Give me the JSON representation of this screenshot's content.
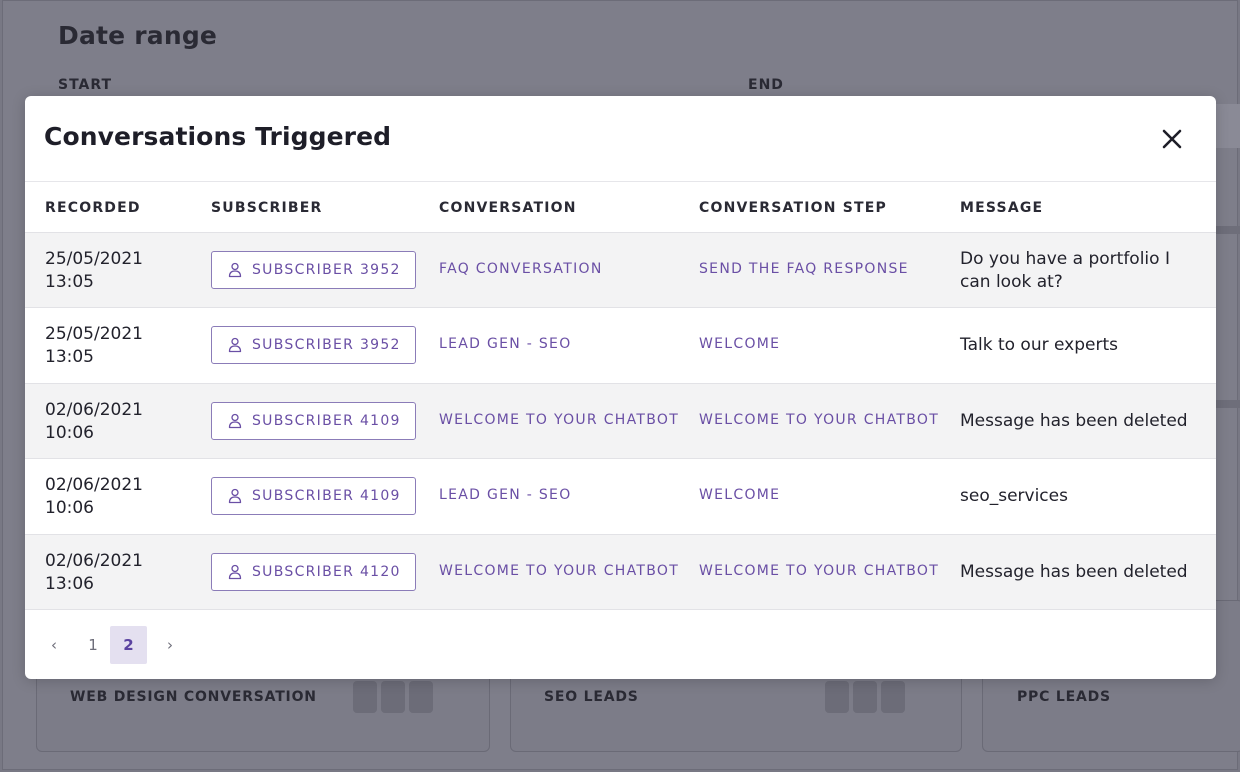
{
  "background": {
    "section_title": "Date range",
    "start_label": "START",
    "end_label": "END",
    "tiles": [
      {
        "label": "WEB DESIGN CONVERSATION"
      },
      {
        "label": "SEO LEADS"
      },
      {
        "label": "PPC LEADS"
      }
    ]
  },
  "modal": {
    "title": "Conversations Triggered",
    "columns": {
      "recorded": "RECORDED",
      "subscriber": "SUBSCRIBER",
      "conversation": "CONVERSATION",
      "step": "CONVERSATION STEP",
      "message": "MESSAGE"
    },
    "rows": [
      {
        "date": "25/05/2021",
        "time": "13:05",
        "subscriber": "SUBSCRIBER 3952",
        "conversation": "FAQ CONVERSATION",
        "step": "SEND THE FAQ RESPONSE",
        "message": "Do you have a portfolio I can look at?"
      },
      {
        "date": "25/05/2021",
        "time": "13:05",
        "subscriber": "SUBSCRIBER 3952",
        "conversation": "LEAD GEN - SEO",
        "step": "WELCOME",
        "message": "Talk to our experts"
      },
      {
        "date": "02/06/2021",
        "time": "10:06",
        "subscriber": "SUBSCRIBER 4109",
        "conversation": "WELCOME TO YOUR CHATBOT",
        "step": "WELCOME TO YOUR CHATBOT",
        "message": "Message has been deleted"
      },
      {
        "date": "02/06/2021",
        "time": "10:06",
        "subscriber": "SUBSCRIBER 4109",
        "conversation": "LEAD GEN - SEO",
        "step": "WELCOME",
        "message": "seo_services"
      },
      {
        "date": "02/06/2021",
        "time": "13:06",
        "subscriber": "SUBSCRIBER 4120",
        "conversation": "WELCOME TO YOUR CHATBOT",
        "step": "WELCOME TO YOUR CHATBOT",
        "message": "Message has been deleted"
      }
    ],
    "pagination": {
      "prev": "‹",
      "pages": [
        "1",
        "2"
      ],
      "current": "2",
      "next": "›"
    }
  },
  "colors": {
    "accent": "#6a4fa5",
    "overlay": "#787884",
    "row_shade": "#f3f3f4",
    "active_page_bg": "#e4e0f0"
  },
  "icons": {
    "close": "close-icon",
    "subscriber": "user-icon",
    "prev": "chevron-left-icon",
    "next": "chevron-right-icon"
  }
}
